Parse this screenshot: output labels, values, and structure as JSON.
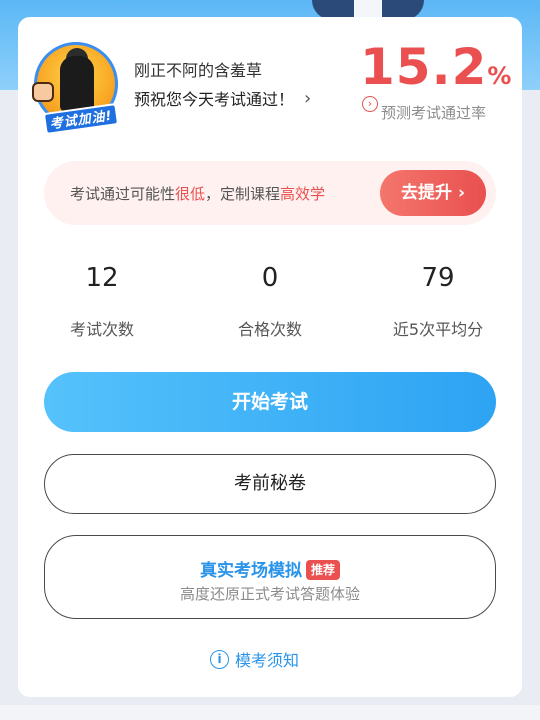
{
  "profile": {
    "username": "刚正不阿的含羞草",
    "greeting": "预祝您今天考试通过！",
    "avatar_badge": "考试加油!"
  },
  "pass_rate": {
    "value": "15.2",
    "unit": "%",
    "label": "预测考试通过率"
  },
  "promo": {
    "text_prefix": "考试通过可能性",
    "text_low": "很低",
    "text_mid": "，定制课程",
    "text_high": "高效学",
    "button_label": "去提升"
  },
  "stats": [
    {
      "value": "12",
      "label": "考试次数"
    },
    {
      "value": "0",
      "label": "合格次数"
    },
    {
      "value": "79",
      "label": "近5次平均分"
    }
  ],
  "buttons": {
    "start": "开始考试",
    "secret": "考前秘卷",
    "mock_title": "真实考场模拟",
    "mock_tag": "推荐",
    "mock_sub": "高度还原正式考试答题体验"
  },
  "notice": "模考须知",
  "colors": {
    "accent_red": "#e9504f",
    "accent_blue": "#2da3f3"
  }
}
